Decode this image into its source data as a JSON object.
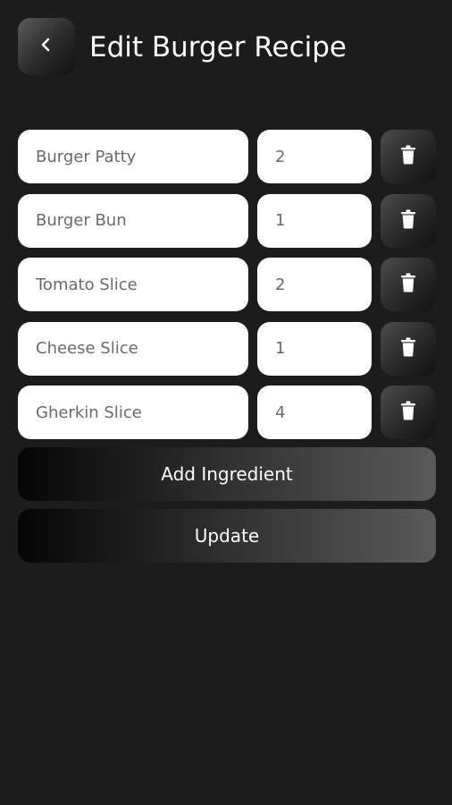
{
  "header": {
    "title": "Edit Burger Recipe",
    "back_icon": "chevron-left-icon"
  },
  "ingredients": [
    {
      "name": "Burger Patty",
      "quantity": "2"
    },
    {
      "name": "Burger Bun",
      "quantity": "1"
    },
    {
      "name": "Tomato Slice",
      "quantity": "2"
    },
    {
      "name": "Cheese Slice",
      "quantity": "1"
    },
    {
      "name": "Gherkin Slice",
      "quantity": "4"
    }
  ],
  "delete_icon": "trash-icon",
  "actions": {
    "add_label": "Add Ingredient",
    "update_label": "Update"
  },
  "colors": {
    "background": "#1c1c1c",
    "field": "#ffffff",
    "field_text": "#6a6a6a",
    "text": "#ffffff"
  }
}
